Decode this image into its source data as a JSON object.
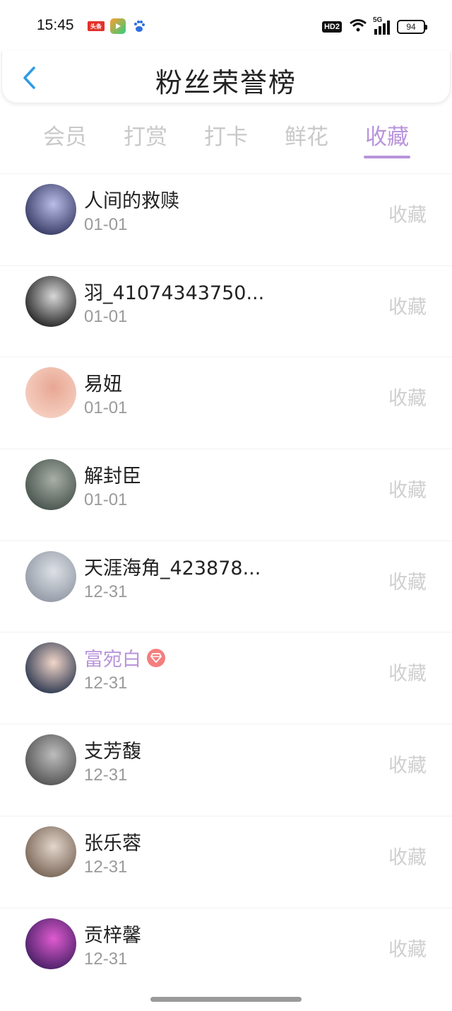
{
  "status_bar": {
    "time": "15:45",
    "app_icons": [
      "toutiao-icon",
      "video-app-icon",
      "baidu-icon"
    ],
    "hd_label": "HD2",
    "network_label": "5G",
    "battery": "94"
  },
  "header": {
    "title": "粉丝荣誉榜",
    "back_icon": "chevron-left-icon"
  },
  "tabs": [
    {
      "label": "会员",
      "active": false
    },
    {
      "label": "打赏",
      "active": false
    },
    {
      "label": "打卡",
      "active": false
    },
    {
      "label": "鲜花",
      "active": false
    },
    {
      "label": "收藏",
      "active": true
    }
  ],
  "items": [
    {
      "name": "人间的救赎",
      "date": "01-01",
      "action": "收藏",
      "avatar_colors": [
        "#2b2f58",
        "#b9bde8"
      ]
    },
    {
      "name": "羽_41074343750...",
      "date": "01-01",
      "action": "收藏",
      "avatar_colors": [
        "#151515",
        "#d8d8d8"
      ]
    },
    {
      "name": "易妞",
      "date": "01-01",
      "action": "收藏",
      "avatar_colors": [
        "#f7d3c5",
        "#e8a794"
      ]
    },
    {
      "name": "解封臣",
      "date": "01-01",
      "action": "收藏",
      "avatar_colors": [
        "#3e4b45",
        "#a9b0a6"
      ]
    },
    {
      "name": "天涯海角_423878...",
      "date": "12-31",
      "action": "收藏",
      "avatar_colors": [
        "#8c93a0",
        "#dde1e6"
      ]
    },
    {
      "name": "富宛白",
      "date": "12-31",
      "action": "收藏",
      "vip": true,
      "avatar_colors": [
        "#1b2a45",
        "#f2d6c9"
      ]
    },
    {
      "name": "支芳馥",
      "date": "12-31",
      "action": "收藏",
      "avatar_colors": [
        "#4a4a4a",
        "#bdbdbd"
      ]
    },
    {
      "name": "张乐蓉",
      "date": "12-31",
      "action": "收藏",
      "avatar_colors": [
        "#6e5b4c",
        "#e4d6cc"
      ]
    },
    {
      "name": "贡梓馨",
      "date": "12-31",
      "action": "收藏",
      "avatar_colors": [
        "#3a1a5c",
        "#e05bd1"
      ]
    }
  ],
  "colors": {
    "accent": "#b994db",
    "vip_badge": "#f47e7e",
    "inactive_tab": "#c9c9c9",
    "back_arrow": "#2f9ae8"
  }
}
